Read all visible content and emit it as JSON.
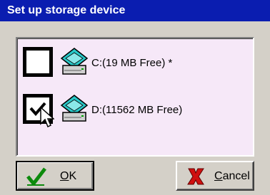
{
  "window": {
    "title": "Set up storage device"
  },
  "drives": [
    {
      "label": "C:(19 MB Free) *",
      "checked": false,
      "icon": "drive-icon"
    },
    {
      "label": "D:(11562 MB Free)",
      "checked": true,
      "icon": "drive-icon"
    }
  ],
  "buttons": {
    "ok": {
      "mnemonic": "O",
      "rest": "K",
      "icon": "checkmark-icon"
    },
    "cancel": {
      "mnemonic": "C",
      "rest": "ancel",
      "icon": "x-icon"
    }
  }
}
